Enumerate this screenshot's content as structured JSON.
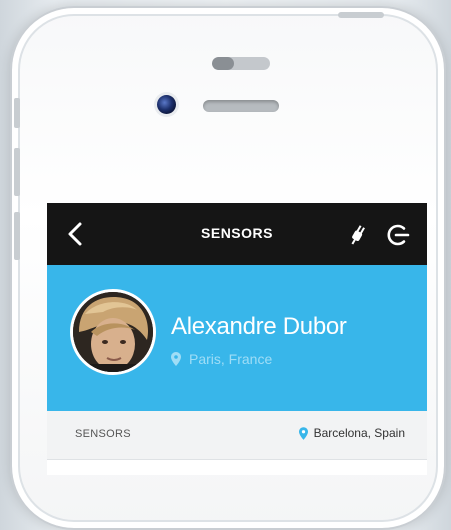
{
  "header": {
    "title": "SENSORS",
    "back_icon": "chevron-left-icon",
    "plug_icon": "plug-icon",
    "logout_icon": "logout-icon"
  },
  "profile": {
    "name": "Alexandre Dubor",
    "location": "Paris, France",
    "accent_color": "#38b6ea"
  },
  "section": {
    "title": "SENSORS",
    "location": "Barcelona, Spain"
  }
}
